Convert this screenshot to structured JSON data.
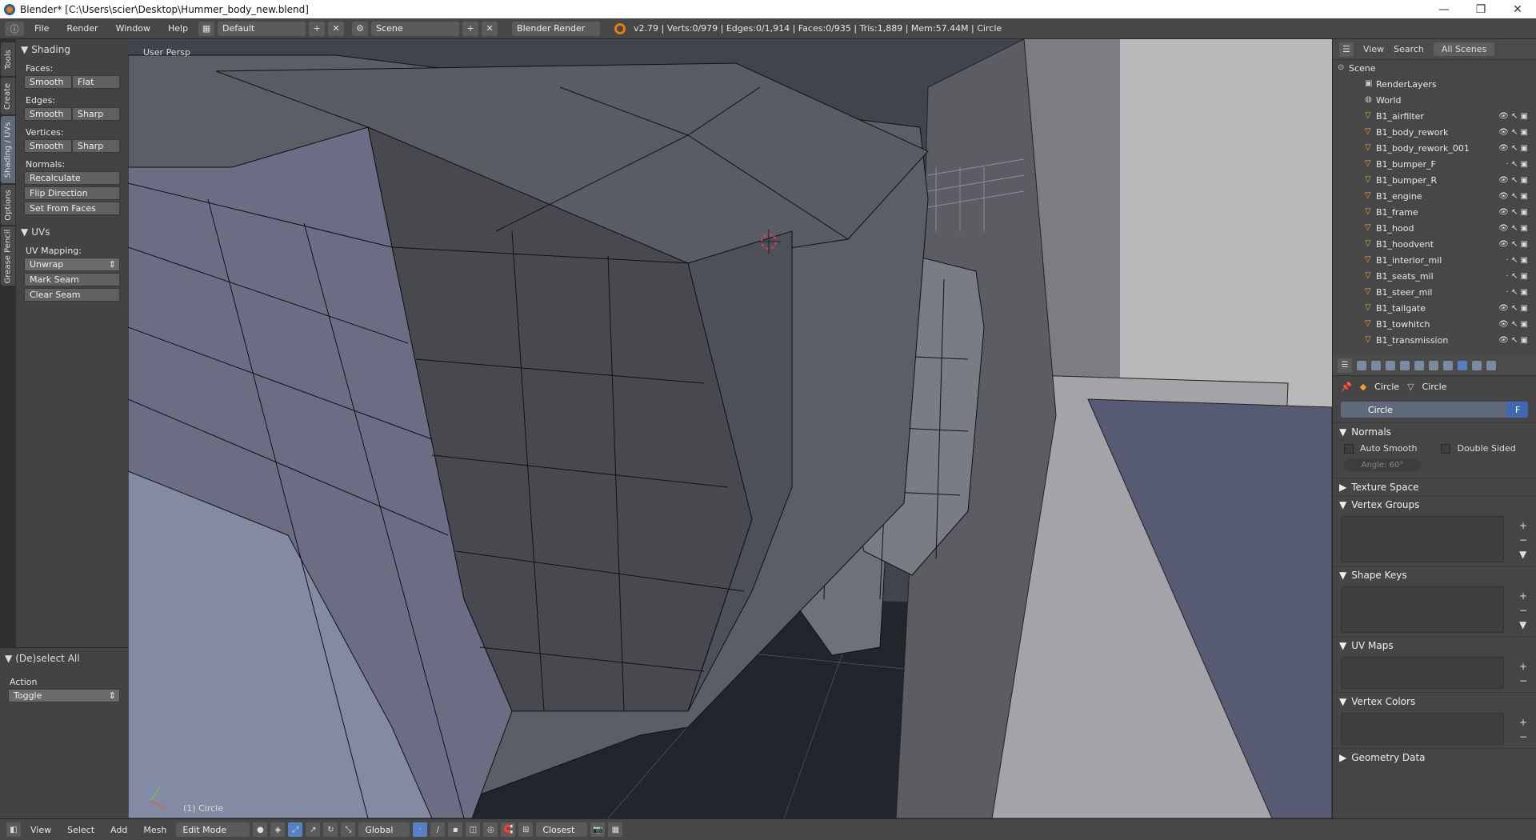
{
  "window": {
    "title": "Blender* [C:\\Users\\scier\\Desktop\\Hummer_body_new.blend]"
  },
  "infobar": {
    "menus": [
      "File",
      "Render",
      "Window",
      "Help"
    ],
    "layout": "Default",
    "scene": "Scene",
    "engine": "Blender Render",
    "stats": "v2.79 | Verts:0/979 | Edges:0/1,914 | Faces:0/935 | Tris:1,889 | Mem:57.44M | Circle"
  },
  "vtabs": [
    "Tools",
    "Create",
    "Shading / UVs",
    "Options",
    "Grease Pencil"
  ],
  "toolshelf": {
    "shading_title": "Shading",
    "faces_label": "Faces:",
    "edges_label": "Edges:",
    "vertices_label": "Vertices:",
    "normals_label": "Normals:",
    "smooth": "Smooth",
    "flat": "Flat",
    "sharp": "Sharp",
    "recalculate": "Recalculate",
    "flip_direction": "Flip Direction",
    "set_from_faces": "Set From Faces",
    "uvs_title": "UVs",
    "uv_mapping_label": "UV Mapping:",
    "unwrap": "Unwrap",
    "mark_seam": "Mark Seam",
    "clear_seam": "Clear Seam"
  },
  "redo_panel": {
    "title": "(De)select All",
    "action_label": "Action",
    "action_value": "Toggle"
  },
  "viewport": {
    "view_label": "User Persp",
    "object_label": "(1) Circle"
  },
  "outliner": {
    "tabs": [
      "View",
      "Search",
      "All Scenes"
    ],
    "items": [
      "Scene",
      "RenderLayers",
      "World",
      "B1_airfilter",
      "B1_body_rework",
      "B1_body_rework_001",
      "B1_bumper_F",
      "B1_bumper_R",
      "B1_engine",
      "B1_frame",
      "B1_hood",
      "B1_hoodvent",
      "B1_interior_mil",
      "B1_seats_mil",
      "B1_steer_mil",
      "B1_tailgate",
      "B1_towhitch",
      "B1_transmission"
    ]
  },
  "properties": {
    "crumb_object": "Circle",
    "crumb_mesh": "Circle",
    "mesh_name": "Circle",
    "fake_user": "F",
    "normals": "Normals",
    "auto_smooth": "Auto Smooth",
    "double_sided": "Double Sided",
    "angle": "Angle:    60°",
    "sections": [
      "Texture Space",
      "Vertex Groups",
      "Shape Keys",
      "UV Maps",
      "Vertex Colors",
      "Geometry Data"
    ]
  },
  "bottombar": {
    "menus": [
      "View",
      "Select",
      "Add",
      "Mesh"
    ],
    "mode": "Edit Mode",
    "orientation": "Global",
    "snap": "Closest"
  }
}
